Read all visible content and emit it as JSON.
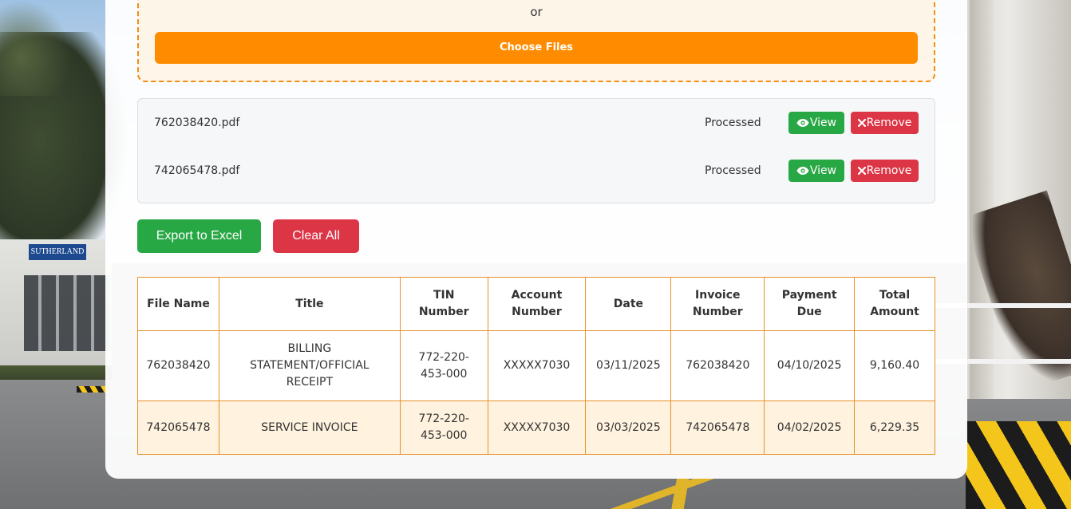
{
  "background": {
    "sign_text": "SUTHERLAND"
  },
  "upload": {
    "or_text": "or",
    "choose_label": "Choose Files"
  },
  "files": [
    {
      "name": "762038420.pdf",
      "status": "Processed",
      "view_label": "View",
      "remove_label": "Remove"
    },
    {
      "name": "742065478.pdf",
      "status": "Processed",
      "view_label": "View",
      "remove_label": "Remove"
    }
  ],
  "actions": {
    "export_label": "Export to Excel",
    "clear_label": "Clear All"
  },
  "table": {
    "headers": {
      "file_name": "File Name",
      "title": "Title",
      "tin": "TIN Number",
      "account": "Account Number",
      "date": "Date",
      "invoice": "Invoice Number",
      "payment_due": "Payment Due",
      "total": "Total Amount"
    },
    "rows": [
      {
        "file_name": "762038420",
        "title": "BILLING STATEMENT/OFFICIAL RECEIPT",
        "tin": "772-220-453-000",
        "account": "XXXXX7030",
        "date": "03/11/2025",
        "invoice": "762038420",
        "payment_due": "04/10/2025",
        "total": "9,160.40"
      },
      {
        "file_name": "742065478",
        "title": "SERVICE INVOICE",
        "tin": "772-220-453-000",
        "account": "XXXXX7030",
        "date": "03/03/2025",
        "invoice": "742065478",
        "payment_due": "04/02/2025",
        "total": "6,229.35"
      }
    ]
  },
  "colors": {
    "accent_orange": "#ff8c00",
    "success_green": "#28a745",
    "danger_red": "#dc3545",
    "table_border": "#e8912a",
    "row_highlight": "#fff2de"
  },
  "icons": {
    "view": "eye-icon",
    "remove": "close-icon"
  }
}
